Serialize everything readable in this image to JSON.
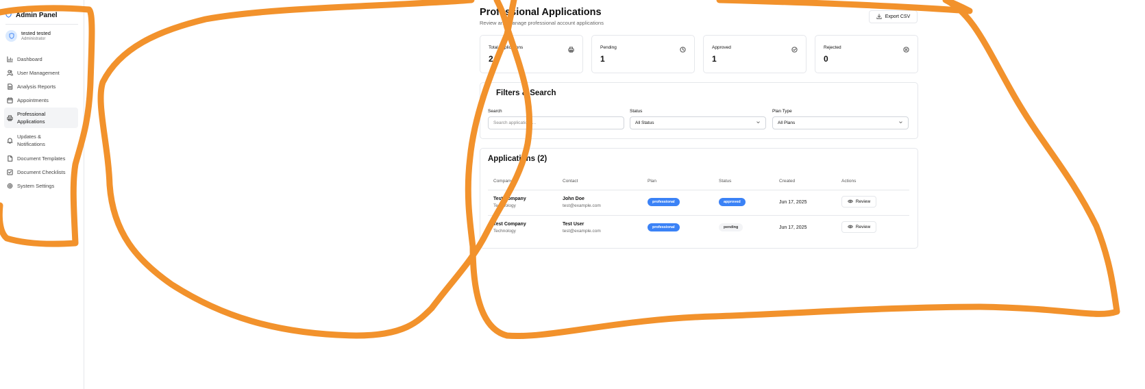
{
  "sidebar": {
    "brand": "Admin Panel",
    "user_name": "tested tested",
    "user_role": "Administrator",
    "items": [
      {
        "label": "Dashboard",
        "icon": "bar-chart-icon"
      },
      {
        "label": "User Management",
        "icon": "users-icon"
      },
      {
        "label": "Analysis Reports",
        "icon": "file-text-icon"
      },
      {
        "label": "Appointments",
        "icon": "calendar-icon"
      },
      {
        "label": "Professional Applications",
        "icon": "printer-icon"
      },
      {
        "label": "Updates & Notifications",
        "icon": "bell-icon"
      },
      {
        "label": "Document Templates",
        "icon": "file-icon"
      },
      {
        "label": "Document Checklists",
        "icon": "check-square-icon"
      },
      {
        "label": "System Settings",
        "icon": "gear-icon"
      }
    ]
  },
  "header": {
    "title": "Professional Applications",
    "subtitle": "Review and manage professional account applications",
    "export_label": "Export CSV"
  },
  "stats": [
    {
      "label": "Total Applications",
      "value": "2",
      "icon": "printer-icon"
    },
    {
      "label": "Pending",
      "value": "1",
      "icon": "clock-icon"
    },
    {
      "label": "Approved",
      "value": "1",
      "icon": "check-circle-icon"
    },
    {
      "label": "Rejected",
      "value": "0",
      "icon": "x-circle-icon"
    }
  ],
  "filters": {
    "title": "Filters & Search",
    "search_label": "Search",
    "search_placeholder": "Search applications...",
    "status_label": "Status",
    "status_value": "All Status",
    "plan_label": "Plan Type",
    "plan_value": "All Plans"
  },
  "applications": {
    "title": "Applications (2)",
    "columns": [
      "Company",
      "Contact",
      "Plan",
      "Status",
      "Created",
      "Actions"
    ],
    "rows": [
      {
        "company": "Test Company",
        "industry": "Technology",
        "contact": "John Doe",
        "email": "test@example.com",
        "plan": "professional",
        "status": "approved",
        "created": "Jun 17, 2025",
        "action": "Review"
      },
      {
        "company": "Test Company",
        "industry": "Technology",
        "contact": "Test User",
        "email": "test@example.com",
        "plan": "professional",
        "status": "pending",
        "created": "Jun 17, 2025",
        "action": "Review"
      }
    ]
  },
  "colors": {
    "accent": "#3b82f6",
    "annotation": "#f2922c",
    "border": "#e5e7eb"
  }
}
